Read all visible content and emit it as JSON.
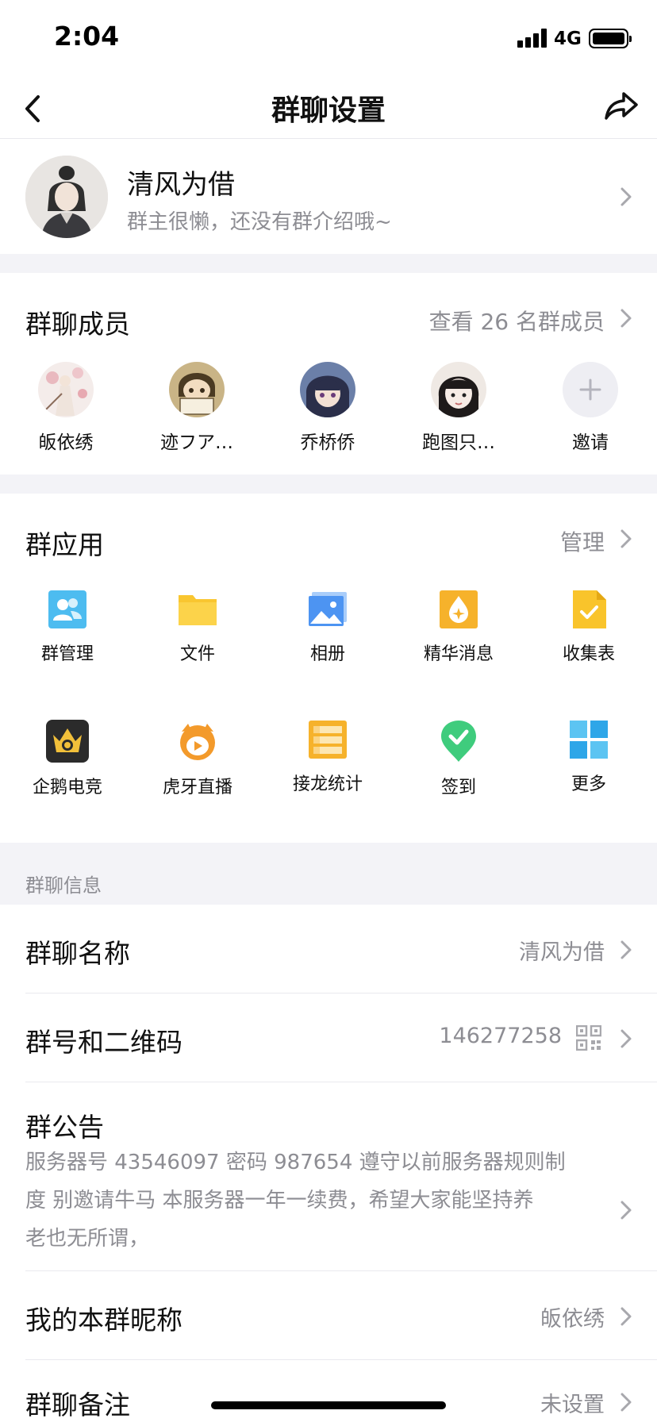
{
  "status_bar": {
    "time": "2:04",
    "network": "4G"
  },
  "nav": {
    "title": "群聊设置",
    "back_icon": "chevron-left-icon",
    "share_icon": "share-icon"
  },
  "profile": {
    "name": "清风为借",
    "description": "群主很懒，还没有群介绍哦~"
  },
  "members": {
    "title": "群聊成员",
    "view_all": "查看 26 名群成员",
    "list": [
      {
        "name": "皈依绣"
      },
      {
        "name": "迹フア…"
      },
      {
        "name": "乔桥侨"
      },
      {
        "name": "跑图只…"
      }
    ],
    "invite_label": "邀请"
  },
  "apps": {
    "title": "群应用",
    "manage": "管理",
    "items": [
      {
        "name": "群管理",
        "icon": "group-manage-icon"
      },
      {
        "name": "文件",
        "icon": "folder-icon"
      },
      {
        "name": "相册",
        "icon": "photo-album-icon"
      },
      {
        "name": "精华消息",
        "icon": "essence-message-icon"
      },
      {
        "name": "收集表",
        "icon": "collection-form-icon"
      },
      {
        "name": "企鹅电竞",
        "icon": "penguin-esports-icon"
      },
      {
        "name": "虎牙直播",
        "icon": "huya-live-icon"
      },
      {
        "name": "接龙统计",
        "icon": "relay-stats-icon"
      },
      {
        "name": "签到",
        "icon": "check-in-icon"
      },
      {
        "name": "更多",
        "icon": "more-grid-icon"
      }
    ]
  },
  "info": {
    "caption": "群聊信息",
    "group_name_label": "群聊名称",
    "group_name_value": "清风为借",
    "group_id_label": "群号和二维码",
    "group_id_value": "146277258",
    "notice_label": "群公告",
    "notice_line1": "服务器号 43546097 密码 987654 遵守以前服务器规则制",
    "notice_line2": "度 别邀请牛马 本服务器一年一续费，希望大家能坚持养",
    "notice_line3": "老也无所谓，",
    "nickname_label": "我的本群昵称",
    "nickname_value": "皈依绣",
    "remark_label": "群聊备注",
    "remark_value": "未设置"
  },
  "colors": {
    "background": "#ffffff",
    "separator": "#f3f3f7",
    "secondary_text": "#8d8d93"
  }
}
